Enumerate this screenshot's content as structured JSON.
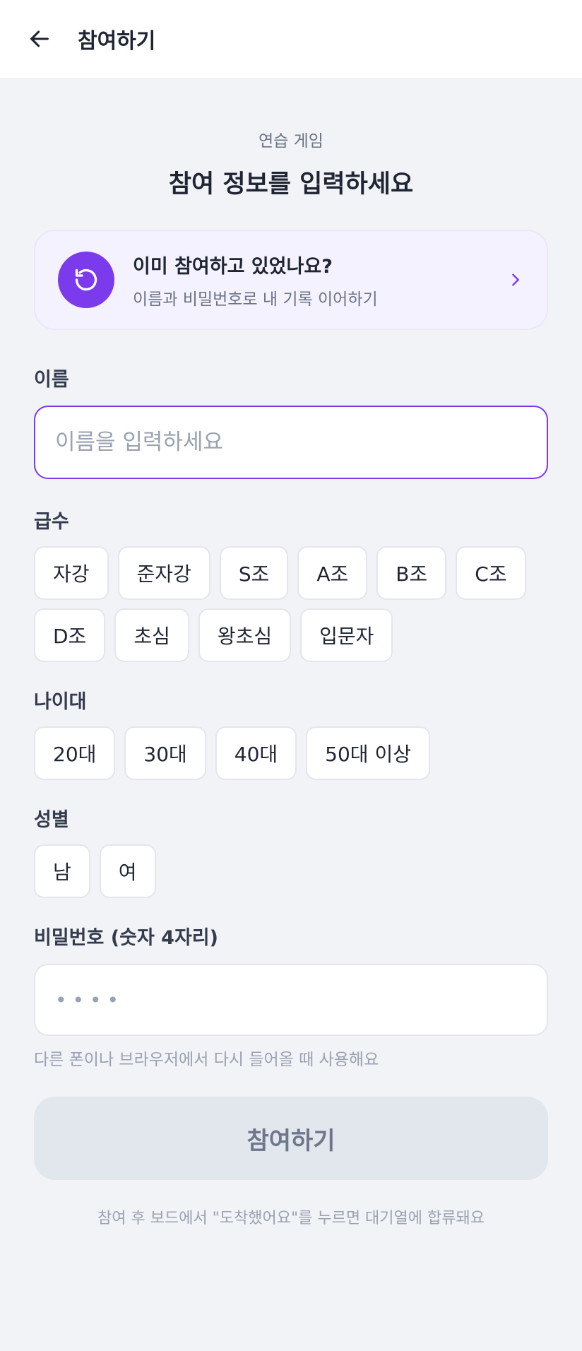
{
  "header": {
    "title": "참여하기",
    "back_icon": "arrow-left-icon"
  },
  "intro": {
    "subtitle": "연습 게임",
    "title": "참여 정보를 입력하세요"
  },
  "resume_card": {
    "title": "이미 참여하고 있었나요?",
    "description": "이름과 비밀번호로 내 기록 이어하기",
    "icon": "restart-icon",
    "chevron": "chevron-right-icon"
  },
  "name_section": {
    "label": "이름",
    "placeholder": "이름을 입력하세요",
    "value": ""
  },
  "grade_section": {
    "label": "급수",
    "options": [
      "자강",
      "준자강",
      "S조",
      "A조",
      "B조",
      "C조",
      "D조",
      "초심",
      "왕초심",
      "입문자"
    ]
  },
  "age_section": {
    "label": "나이대",
    "options": [
      "20대",
      "30대",
      "40대",
      "50대 이상"
    ]
  },
  "gender_section": {
    "label": "성별",
    "options": [
      "남",
      "여"
    ]
  },
  "password_section": {
    "label": "비밀번호 (숫자 4자리)",
    "placeholder": "••••",
    "help": "다른 폰이나 브라우저에서 다시 들어올 때 사용해요"
  },
  "submit": {
    "label": "참여하기"
  },
  "footer_note": "참여 후 보드에서 \"도착했어요\"를 누르면 대기열에 합류돼요",
  "colors": {
    "accent": "#7c3aed",
    "background": "#f1f3f7",
    "card_bg": "#f5f2ff",
    "disabled_button": "#e2e6ed"
  }
}
